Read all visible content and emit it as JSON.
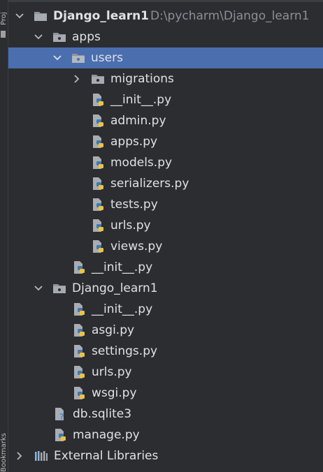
{
  "side_panel": {
    "top_label": "Proj",
    "bottom_label": "Bookmarks"
  },
  "tree": {
    "root": {
      "label": "Django_learn1",
      "path": "D:\\pycharm\\Django_learn1"
    },
    "apps": {
      "label": "apps"
    },
    "users": {
      "label": "users"
    },
    "migrations": {
      "label": "migrations"
    },
    "users_init": {
      "label": "__init__.py"
    },
    "admin": {
      "label": "admin.py"
    },
    "users_apps": {
      "label": "apps.py"
    },
    "models": {
      "label": "models.py"
    },
    "serializers": {
      "label": "serializers.py"
    },
    "tests": {
      "label": "tests.py"
    },
    "users_urls": {
      "label": "urls.py"
    },
    "views": {
      "label": "views.py"
    },
    "apps_init": {
      "label": "__init__.py"
    },
    "project_pkg": {
      "label": "Django_learn1"
    },
    "pkg_init": {
      "label": "__init__.py"
    },
    "asgi": {
      "label": "asgi.py"
    },
    "settings": {
      "label": "settings.py"
    },
    "pkg_urls": {
      "label": "urls.py"
    },
    "wsgi": {
      "label": "wsgi.py"
    },
    "db": {
      "label": "db.sqlite3"
    },
    "manage": {
      "label": "manage.py"
    },
    "external": {
      "label": "External Libraries"
    }
  },
  "colors": {
    "background": "#2b2d30",
    "selection": "#4b6eaf",
    "text": "#dfe1e5",
    "muted_text": "#8c8f94",
    "python_blue": "#3d79b5",
    "python_yellow": "#f0c23c"
  },
  "icons": {
    "folder": "folder-icon",
    "python_file": "python-file-icon",
    "unknown_file": "unknown-file-icon",
    "library": "library-icon",
    "chevron_down": "chevron-down-icon",
    "chevron_right": "chevron-right-icon"
  }
}
